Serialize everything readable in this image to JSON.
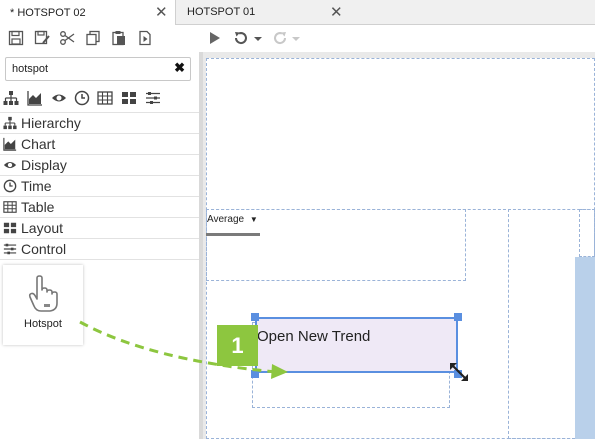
{
  "tabs": [
    {
      "label": "* HOTSPOT 02",
      "active": true
    },
    {
      "label": "HOTSPOT 01",
      "active": false
    }
  ],
  "toolbar": {
    "icons": [
      "save-icon",
      "save-as-icon",
      "cut-icon",
      "copy-icon",
      "paste-icon",
      "export-icon",
      "play-icon",
      "undo-icon",
      "undo-dropdown-icon",
      "redo-icon",
      "redo-dropdown-icon"
    ]
  },
  "sidebar": {
    "search": {
      "value": "hotspot",
      "placeholder": ""
    },
    "filter_icons": [
      "hierarchy-icon",
      "chart-icon",
      "display-icon",
      "time-icon",
      "table-icon",
      "layout-icon",
      "control-icon"
    ],
    "categories": [
      {
        "label": "Hierarchy",
        "icon": "hierarchy-icon"
      },
      {
        "label": "Chart",
        "icon": "chart-icon"
      },
      {
        "label": "Display",
        "icon": "display-icon"
      },
      {
        "label": "Time",
        "icon": "time-icon"
      },
      {
        "label": "Table",
        "icon": "table-icon"
      },
      {
        "label": "Layout",
        "icon": "layout-icon"
      },
      {
        "label": "Control",
        "icon": "control-icon"
      }
    ],
    "palette_item": {
      "label": "Hotspot",
      "icon": "hand-pointer-icon"
    }
  },
  "canvas": {
    "dropdown_label": "Average",
    "hotspot_text": "Open New Trend",
    "step_badge": "1"
  },
  "colors": {
    "accent_green": "#8dc63f",
    "selection_blue": "#5a8fe0",
    "hotspot_fill": "#efe9f6"
  }
}
